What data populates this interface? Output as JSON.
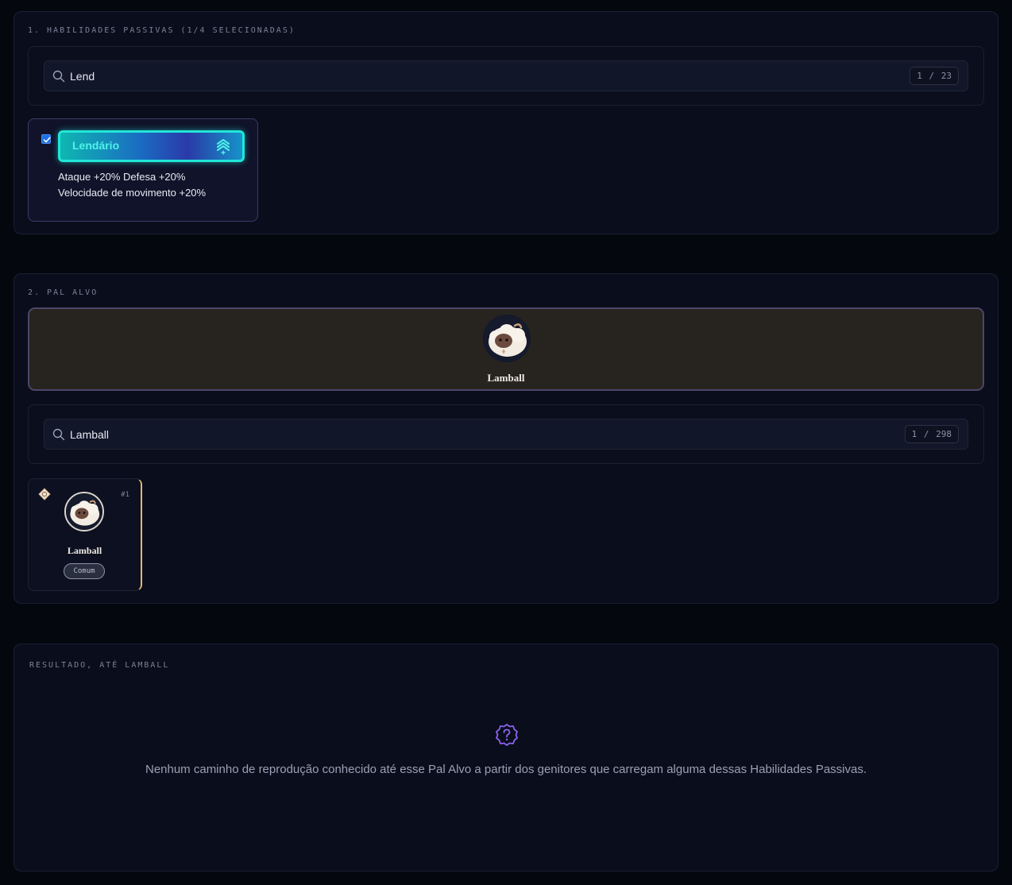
{
  "passives": {
    "title": "1. HABILIDADES PASSIVAS (1/4 SELECIONADAS)",
    "search_value": "Lend",
    "counter": "1 / 23",
    "card": {
      "checked": true,
      "name": "Lendário",
      "desc_line1": "Ataque +20% Defesa +20%",
      "desc_line2": "Velocidade de movimento +20%"
    }
  },
  "target": {
    "title": "2. PAL ALVO",
    "selected_name": "Lamball",
    "search_value": "Lamball",
    "counter": "1 / 298",
    "card": {
      "number": "#1",
      "name": "Lamball",
      "rarity": "Comum"
    }
  },
  "result": {
    "title": "RESULTADO, ATÉ LAMBALL",
    "message": "Nenhum caminho de reprodução conhecido até esse Pal Alvo a partir dos genitores que carregam alguma dessas Habilidades Passivas."
  },
  "icons": {
    "search": "search-icon",
    "rank": "rank-up-icon",
    "element": "neutral-element-icon",
    "help": "question-badge-icon"
  },
  "colors": {
    "legendary_border": "#22e6d8",
    "accent_purple": "#8a63f0",
    "pal_card_border": "#e2b870"
  }
}
